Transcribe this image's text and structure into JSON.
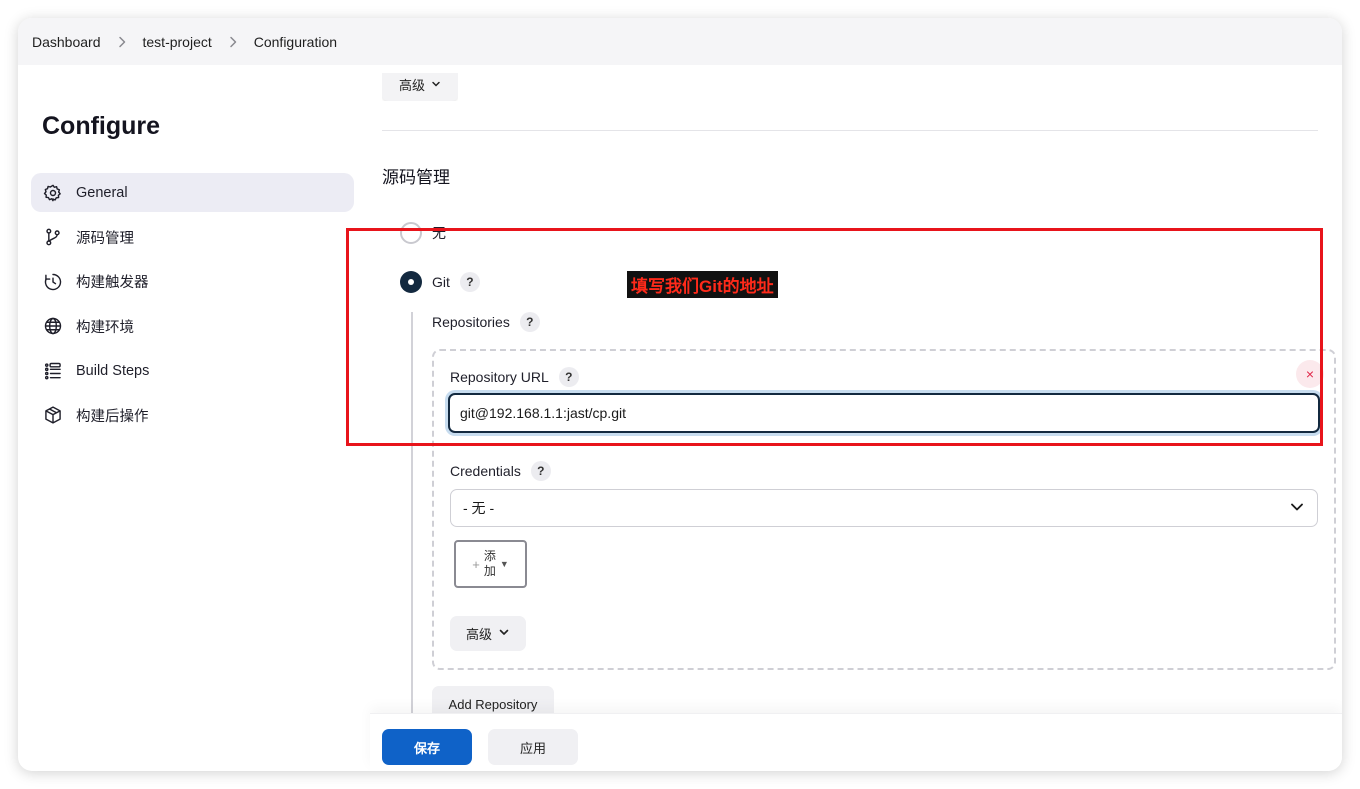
{
  "breadcrumb": [
    "Dashboard",
    "test-project",
    "Configuration"
  ],
  "sidebar": {
    "title": "Configure",
    "items": [
      {
        "label": "General",
        "icon": "gear-icon",
        "active": true
      },
      {
        "label": "源码管理",
        "icon": "branch-icon",
        "active": false
      },
      {
        "label": "构建触发器",
        "icon": "clock-icon",
        "active": false
      },
      {
        "label": "构建环境",
        "icon": "globe-icon",
        "active": false
      },
      {
        "label": "Build Steps",
        "icon": "list-icon",
        "active": false
      },
      {
        "label": "构建后操作",
        "icon": "package-icon",
        "active": false
      }
    ]
  },
  "main": {
    "advanced_top_label": "高级",
    "section_title": "源码管理",
    "scm_options": [
      {
        "label": "无",
        "checked": false
      },
      {
        "label": "Git",
        "checked": true
      }
    ],
    "repositories_label": "Repositories",
    "repository_url_label": "Repository URL",
    "repository_url_value": "git@192.168.1.1:jast/cp.git",
    "delete_symbol": "×",
    "credentials_label": "Credentials",
    "credentials_value": "- 无 -",
    "add_button_label": "添加",
    "advanced_label": "高级",
    "add_repository_label": "Add Repository",
    "help_symbol": "?"
  },
  "footer": {
    "save_label": "保存",
    "apply_label": "应用"
  },
  "annotation": {
    "text": "填写我们Git的地址",
    "color": "#e8141b"
  },
  "colors": {
    "primary": "#0f62c8",
    "radio_checked": "#13293f",
    "danger": "#e0284a"
  }
}
